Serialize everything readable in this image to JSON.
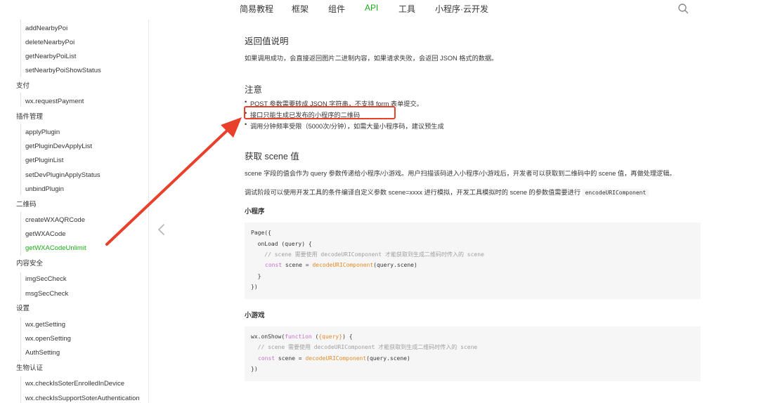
{
  "topnav": {
    "items": [
      {
        "label": "简易教程",
        "active": false
      },
      {
        "label": "框架",
        "active": false
      },
      {
        "label": "组件",
        "active": false
      },
      {
        "label": "API",
        "active": true
      },
      {
        "label": "工具",
        "active": false
      },
      {
        "label": "小程序·云开发",
        "active": false
      }
    ],
    "search_icon": "search-icon",
    "accent_color": "#1aad19"
  },
  "sidebar": {
    "rows": [
      {
        "type": "item",
        "label": "addNearbyPoi"
      },
      {
        "type": "item",
        "label": "deleteNearbyPoi"
      },
      {
        "type": "item",
        "label": "getNearbyPoiList"
      },
      {
        "type": "item",
        "label": "setNearbyPoiShowStatus"
      },
      {
        "type": "group",
        "label": "支付"
      },
      {
        "type": "item",
        "label": "wx.requestPayment"
      },
      {
        "type": "group",
        "label": "插件管理"
      },
      {
        "type": "item",
        "label": "applyPlugin"
      },
      {
        "type": "item",
        "label": "getPluginDevApplyList"
      },
      {
        "type": "item",
        "label": "getPluginList"
      },
      {
        "type": "item",
        "label": "setDevPluginApplyStatus"
      },
      {
        "type": "item",
        "label": "unbindPlugin"
      },
      {
        "type": "group",
        "label": "二维码"
      },
      {
        "type": "item",
        "label": "createWXAQRCode"
      },
      {
        "type": "item",
        "label": "getWXACode"
      },
      {
        "type": "item",
        "label": "getWXACodeUnlimit",
        "active": true
      },
      {
        "type": "group",
        "label": "内容安全"
      },
      {
        "type": "item",
        "label": "imgSecCheck"
      },
      {
        "type": "item",
        "label": "msgSecCheck"
      },
      {
        "type": "group",
        "label": "设置"
      },
      {
        "type": "item",
        "label": "wx.getSetting"
      },
      {
        "type": "item",
        "label": "wx.openSetting"
      },
      {
        "type": "item",
        "label": "AuthSetting"
      },
      {
        "type": "group",
        "label": "生物认证"
      },
      {
        "type": "item",
        "label": "wx.checkIsSoterEnrolledInDevice"
      },
      {
        "type": "item",
        "label": "wx.checkIsSupportSoterAuthentication"
      }
    ]
  },
  "content": {
    "return_title": "返回值说明",
    "return_desc": "如果调用成功，会直接返回图片二进制内容，如果请求失败，会返回 JSON 格式的数据。",
    "notes_title": "注意",
    "notes": [
      "POST 参数需要转成 JSON 字符串，不支持 form 表单提交。",
      "接口只能生成已发布的小程序的二维码",
      "调用分钟频率受限（5000次/分钟），如需大量小程序码，建议预生成"
    ],
    "scene_title": "获取 scene 值",
    "scene_desc": "scene 字段的值会作为 query 参数传递给小程序/小游戏。用户扫描该码进入小程序/小游戏后，开发者可以获取到二维码中的 scene 值，再做处理逻辑。",
    "debug_desc": "调试阶段可以使用开发工具的条件编译自定义参数 scene=xxxx 进行模拟，开发工具模拟时的 scene 的参数值需要进行",
    "debug_code": "encodeURIComponent",
    "miniprogram_title": "小程序",
    "miniprogram_code": {
      "l1": "Page({",
      "l2": "  onLoad (query) {",
      "l3": "    // scene 需要使用 decodeURIComponent 才能获取到生成二维码时传入的 scene",
      "l4_kw": "const",
      "l4_mid": " scene = ",
      "l4_fn": "decodeURIComponent",
      "l4_end": "(query.scene)",
      "l5": "  }",
      "l6": "})"
    },
    "minigame_title": "小游戏",
    "minigame_code": {
      "l1_a": "wx.onShow(",
      "l1_kw": "function",
      "l1_b": " (",
      "l1_param": "{query}",
      "l1_c": ") {",
      "l2": "  // scene 需要使用 decodeURIComponent 才能获取到生成二维码时传入的 scene",
      "l3_kw": "const",
      "l3_mid": " scene = ",
      "l3_fn": "decodeURIComponent",
      "l3_end": "(query.scene)",
      "l4": "})"
    }
  },
  "annotation": {
    "color": "#e8402a"
  },
  "icons": {
    "prev": "chevron-left-icon"
  }
}
